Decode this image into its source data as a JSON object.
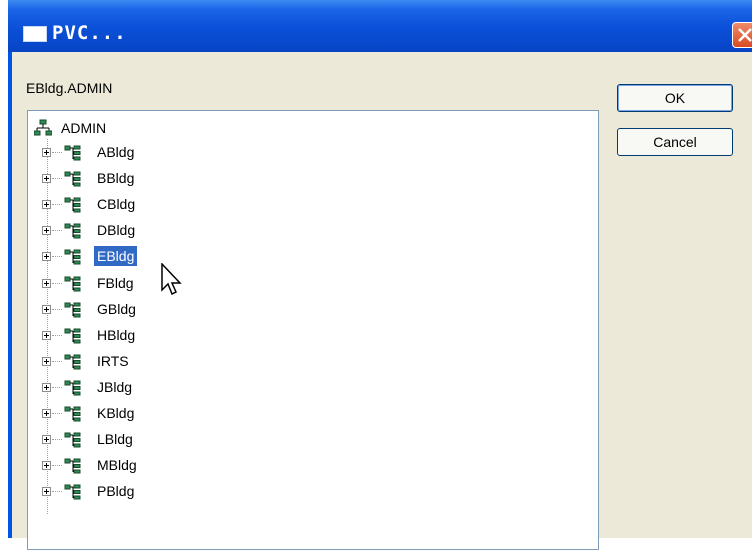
{
  "window": {
    "title": "PVC..."
  },
  "path_label": "EBldg.ADMIN",
  "buttons": {
    "ok": "OK",
    "cancel": "Cancel"
  },
  "tree": {
    "root": {
      "label": "ADMIN",
      "icon": "network-icon"
    },
    "children": [
      {
        "label": "ABldg",
        "selected": false
      },
      {
        "label": "BBldg",
        "selected": false
      },
      {
        "label": "CBldg",
        "selected": false
      },
      {
        "label": "DBldg",
        "selected": false
      },
      {
        "label": "EBldg",
        "selected": true
      },
      {
        "label": "FBldg",
        "selected": false
      },
      {
        "label": "GBldg",
        "selected": false
      },
      {
        "label": "HBldg",
        "selected": false
      },
      {
        "label": "IRTS",
        "selected": false
      },
      {
        "label": "JBldg",
        "selected": false
      },
      {
        "label": "KBldg",
        "selected": false
      },
      {
        "label": "LBldg",
        "selected": false
      },
      {
        "label": "MBldg",
        "selected": false
      },
      {
        "label": "PBldg",
        "selected": false
      }
    ]
  },
  "colors": {
    "selection": "#316ac5",
    "titlebar": "#0a50d8",
    "dialog_bg": "#ece9d8",
    "close_button": "#d84a22"
  }
}
